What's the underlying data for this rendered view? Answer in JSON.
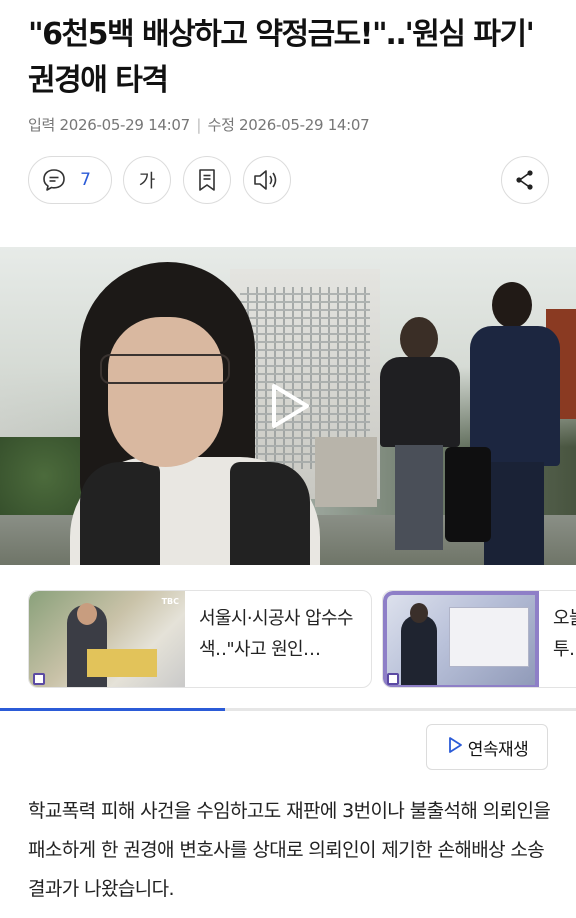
{
  "article": {
    "headline": "\"6천5백 배상하고 약정금도!\"‥'원심 파기' 권경애 타격",
    "meta_published_label": "입력",
    "meta_published": "2026-05-29 14:07",
    "meta_separator": "|",
    "meta_modified_label": "수정",
    "meta_modified": "2026-05-29 14:07",
    "body": "학교폭력 피해 사건을 수임하고도 재판에 3번이나 불출석해 의뢰인을 패소하게 한 권경애 변호사를 상대로 의뢰인이 제기한 손해배상 소송 결과가 나왔습니다."
  },
  "toolbar": {
    "comment_count": "7",
    "font_glyph": "가",
    "icons": [
      "comment-icon",
      "font-size-icon",
      "bookmark-icon",
      "speaker-icon",
      "share-icon"
    ]
  },
  "video": {
    "play_icon": "play-icon"
  },
  "related": [
    {
      "title": "서울시·시공사 압수수색‥\"사고 원인…",
      "badge": "TBC"
    },
    {
      "title": "오늘…전투…",
      "badge": ""
    }
  ],
  "playback": {
    "progress_percent": 39,
    "autoplay_label": "연속재생",
    "autoplay_icon": "play-outline-icon"
  },
  "colors": {
    "accent": "#2b5bd7",
    "text": "#111111",
    "muted": "#777777"
  }
}
